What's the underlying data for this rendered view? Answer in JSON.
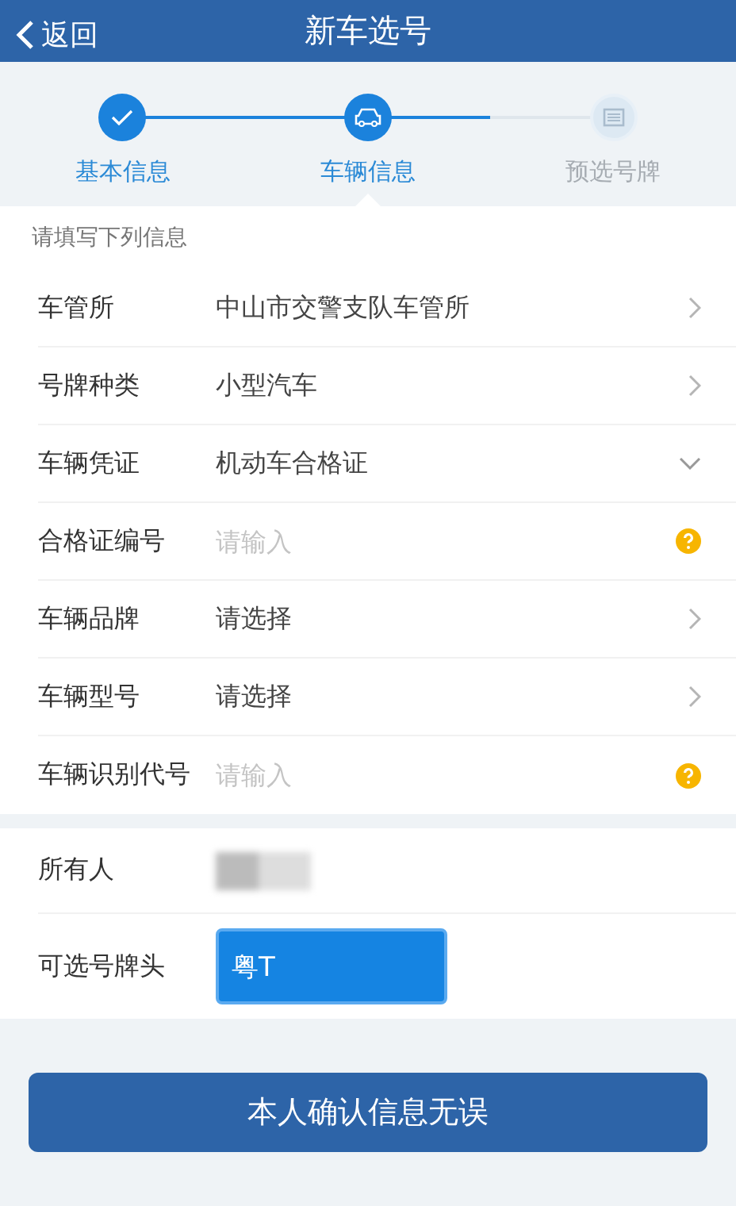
{
  "header": {
    "back": "返回",
    "title": "新车选号"
  },
  "steps": [
    {
      "label": "基本信息",
      "kind": "done"
    },
    {
      "label": "车辆信息",
      "kind": "current"
    },
    {
      "label": "预选号牌",
      "kind": "pending"
    }
  ],
  "form": {
    "heading": "请填写下列信息",
    "rows": [
      {
        "label": "车管所",
        "kind": "select",
        "value": "中山市交警支队车管所"
      },
      {
        "label": "号牌种类",
        "kind": "select",
        "value": "小型汽车"
      },
      {
        "label": "车辆凭证",
        "kind": "dropdown",
        "value": "机动车合格证"
      },
      {
        "label": "合格证编号",
        "kind": "input",
        "placeholder": "请输入"
      },
      {
        "label": "车辆品牌",
        "kind": "select",
        "value": "请选择"
      },
      {
        "label": "车辆型号",
        "kind": "select",
        "value": "请选择"
      },
      {
        "label": "车辆识别代号",
        "kind": "input",
        "placeholder": "请输入"
      }
    ]
  },
  "owner": {
    "rows": [
      {
        "label": "所有人",
        "kind": "redacted"
      },
      {
        "label": "可选号牌头",
        "kind": "plate",
        "value": "粤T",
        "selected": true
      }
    ]
  },
  "confirm_button": "本人确认信息无误"
}
